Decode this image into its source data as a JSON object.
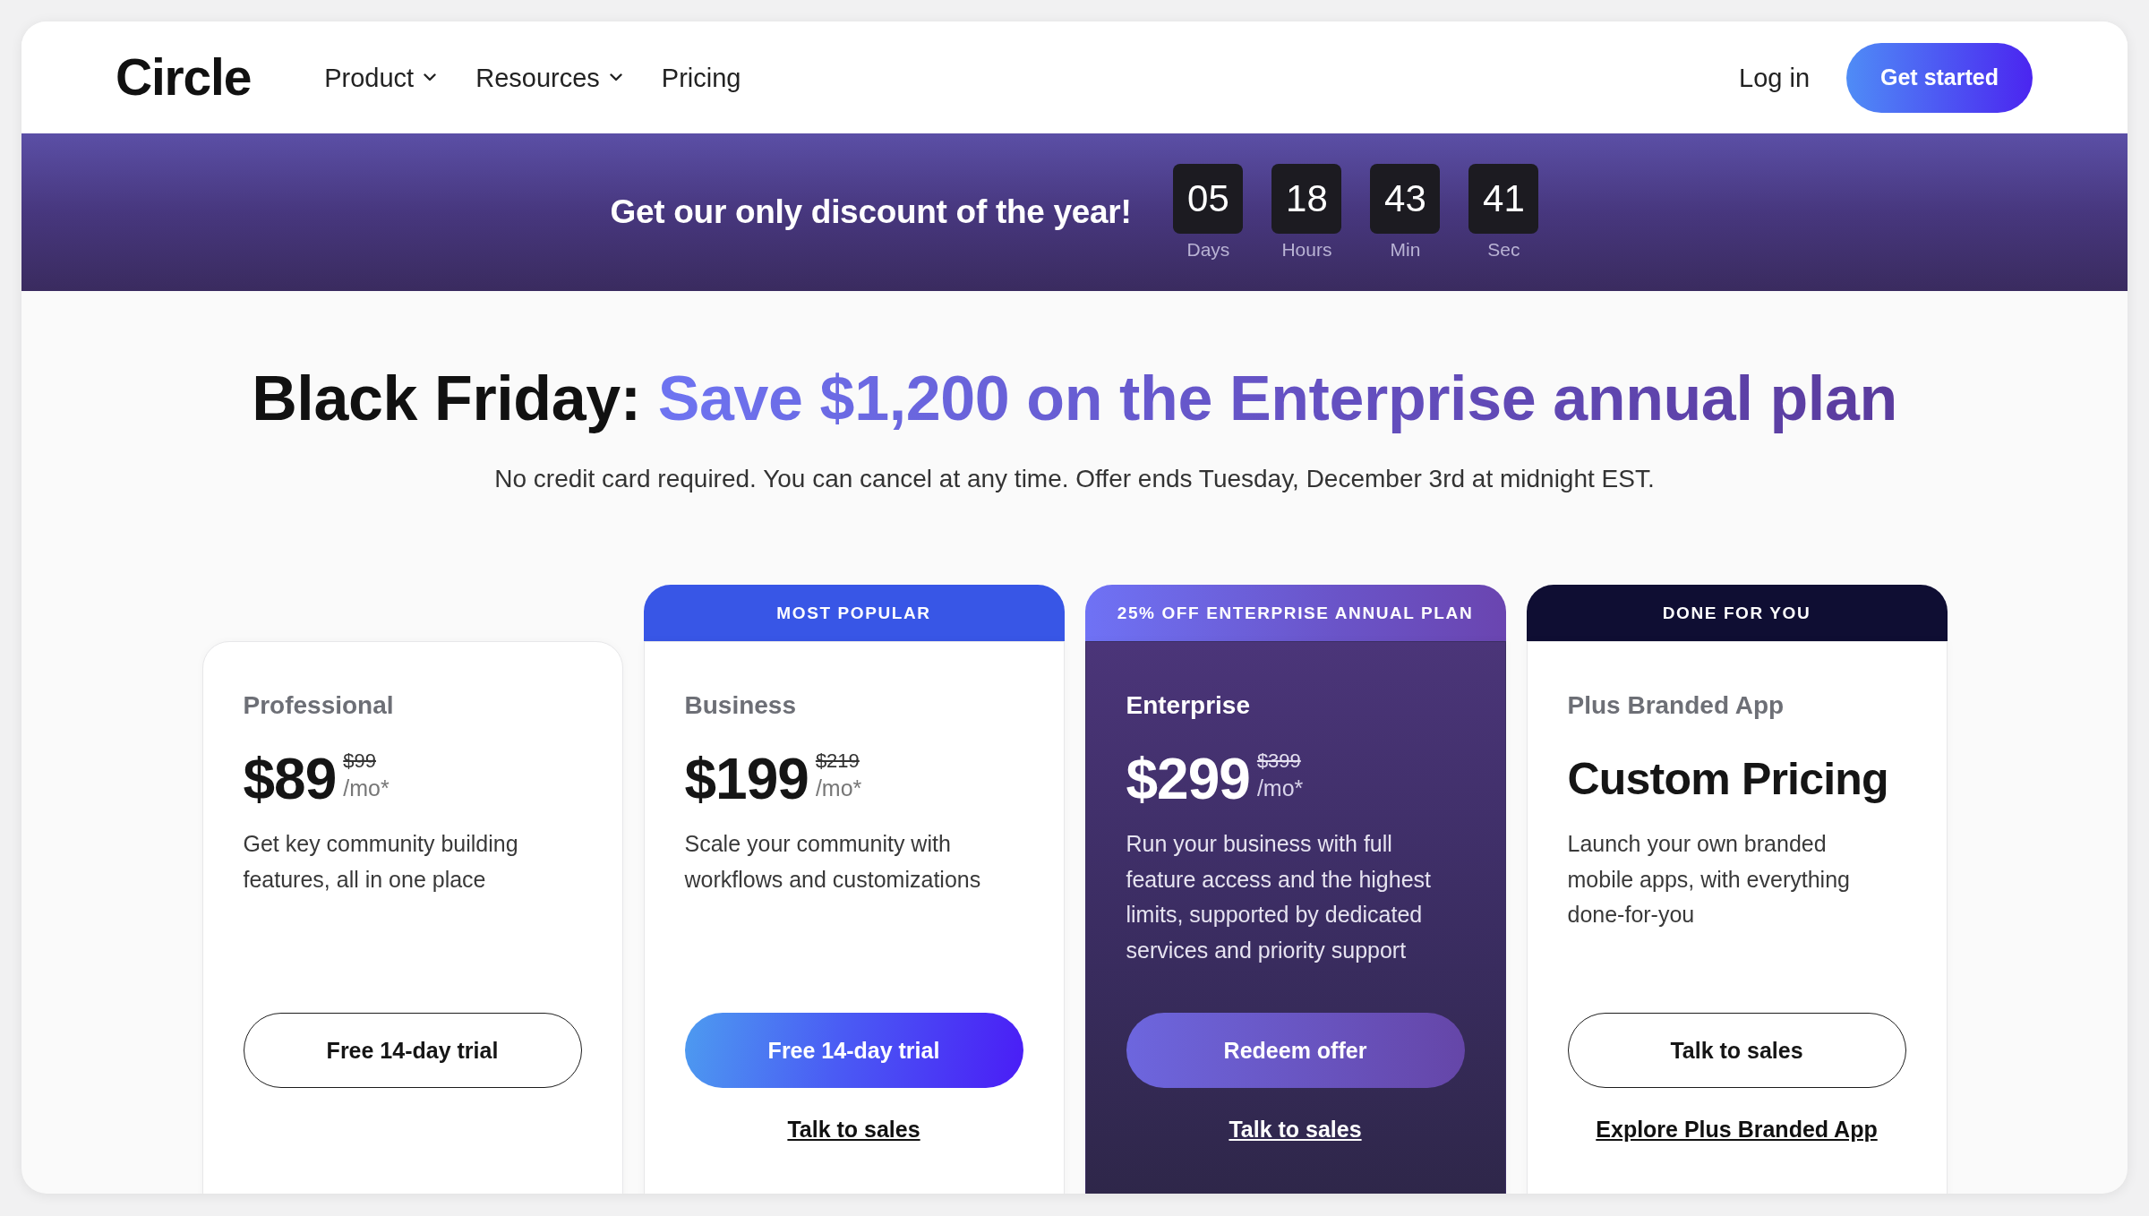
{
  "nav": {
    "logo": "Circle",
    "items": [
      {
        "label": "Product",
        "dropdown": true
      },
      {
        "label": "Resources",
        "dropdown": true
      },
      {
        "label": "Pricing",
        "dropdown": false
      }
    ],
    "login": "Log in",
    "cta": "Get started"
  },
  "promo_banner": {
    "message": "Get our only discount of the year!",
    "countdown": [
      {
        "value": "05",
        "unit": "Days"
      },
      {
        "value": "18",
        "unit": "Hours"
      },
      {
        "value": "43",
        "unit": "Min"
      },
      {
        "value": "41",
        "unit": "Sec"
      }
    ]
  },
  "headline": {
    "lead": "Black Friday:",
    "highlight": "Save $1,200 on the Enterprise annual plan"
  },
  "subtitle": "No credit card required. You can cancel at any time. Offer ends Tuesday, December 3rd at midnight EST.",
  "plans": [
    {
      "kind": "basic",
      "name": "Professional",
      "price": "$89",
      "old_price": "$99",
      "period": "/mo*",
      "description": "Get key community building features, all in one place",
      "button": "Free 14-day trial"
    },
    {
      "kind": "popular",
      "ribbon": "MOST POPULAR",
      "name": "Business",
      "price": "$199",
      "old_price": "$219",
      "period": "/mo*",
      "description": "Scale your community with workflows and customizations",
      "button": "Free 14-day trial",
      "link": "Talk to sales"
    },
    {
      "kind": "offer",
      "ribbon": "25% OFF ENTERPRISE ANNUAL PLAN",
      "name": "Enterprise",
      "price": "$299",
      "old_price": "$399",
      "period": "/mo*",
      "description": "Run your business with full feature access and the highest limits, supported by dedicated services and priority support",
      "button": "Redeem offer",
      "link": "Talk to sales"
    },
    {
      "kind": "service",
      "ribbon": "DONE FOR YOU",
      "name": "Plus Branded App",
      "price_label": "Custom Pricing",
      "description": "Launch your own branded mobile apps, with everything done-for-you",
      "button": "Talk to sales",
      "link": "Explore Plus Branded App"
    }
  ]
}
